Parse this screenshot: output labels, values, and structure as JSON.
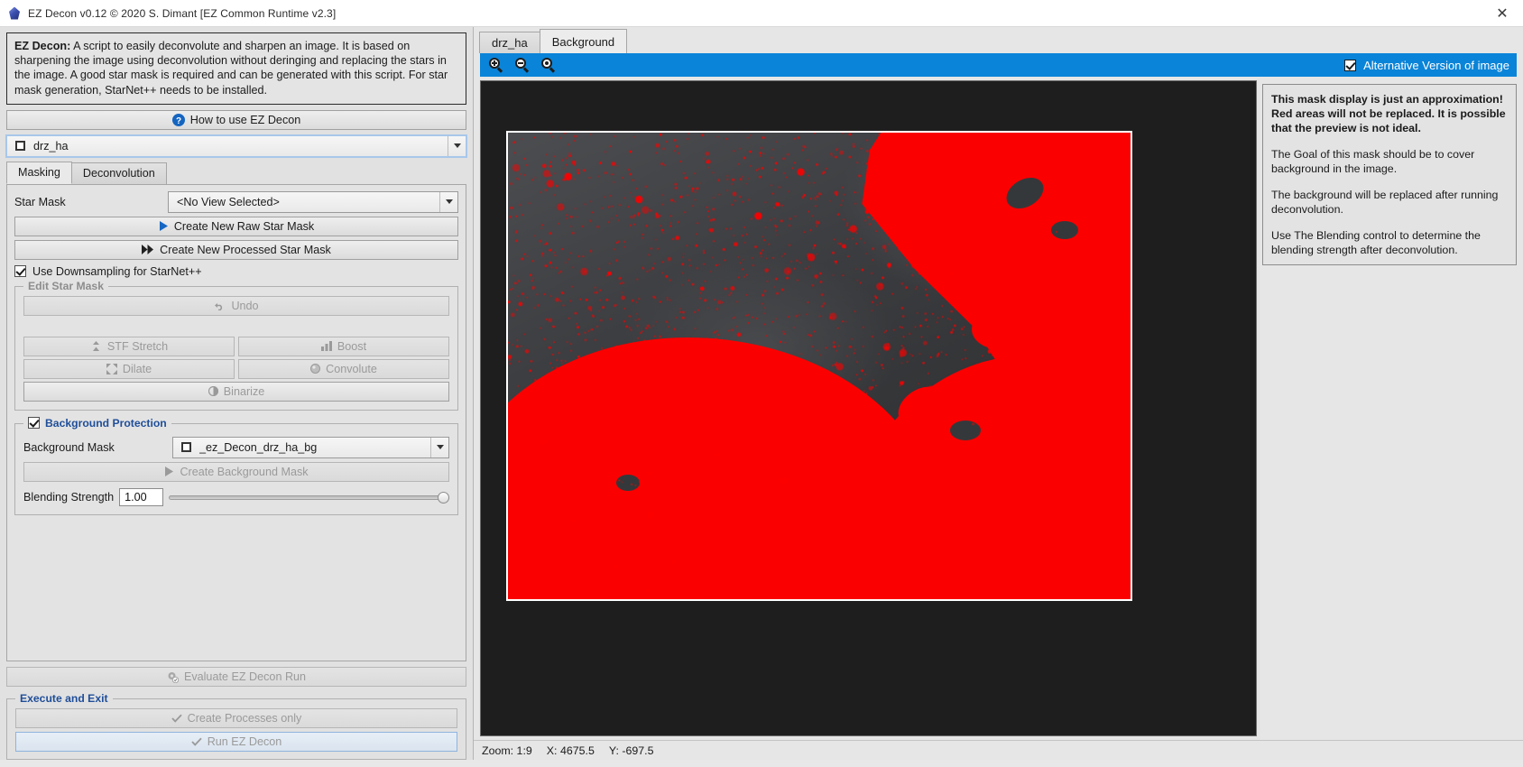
{
  "window": {
    "title": "EZ Decon v0.12 © 2020 S. Dimant [EZ Common Runtime v2.3]",
    "close_label": "✕",
    "app_icon": "diamond-gem-icon"
  },
  "left": {
    "description_lead": "EZ Decon:",
    "description_body": " A script to easily deconvolute and sharpen an image. It is based on sharpening the image using deconvolution without deringing and replacing the stars in the image. A good star mask is required and can be generated with this script. For star mask generation, StarNet++ needs to be installed.",
    "help_button": "How to use EZ Decon",
    "target_view": "drz_ha",
    "tabs": [
      {
        "label": "Masking",
        "active": true
      },
      {
        "label": "Deconvolution",
        "active": false
      }
    ],
    "star_mask": {
      "label": "Star Mask",
      "value": "<No View Selected>",
      "create_raw": "Create New Raw Star Mask",
      "create_processed": "Create New Processed Star Mask",
      "downsampling_label": "Use Downsampling for StarNet++",
      "downsampling_checked": true
    },
    "edit_star_mask": {
      "title": "Edit Star Mask",
      "undo": "Undo",
      "stf_stretch": "STF Stretch",
      "boost": "Boost",
      "dilate": "Dilate",
      "convolute": "Convolute",
      "binarize": "Binarize"
    },
    "background_protection": {
      "title": "Background Protection",
      "checked": true,
      "mask_label": "Background Mask",
      "mask_value": "_ez_Decon_drz_ha_bg",
      "create_mask": "Create Background Mask",
      "blending_label": "Blending Strength",
      "blending_value": "1.00"
    },
    "evaluate_button": "Evaluate EZ Decon Run",
    "execute_group": {
      "title": "Execute and Exit",
      "create_processes": "Create Processes only",
      "run": "Run EZ Decon"
    }
  },
  "right": {
    "tabs": [
      {
        "label": "drz_ha",
        "active": false
      },
      {
        "label": "Background",
        "active": true
      }
    ],
    "toolbar": {
      "zoom_in": "zoom-in-icon",
      "zoom_out": "zoom-out-icon",
      "zoom_fit": "zoom-actual-icon",
      "alt_version_label": "Alternative Version of image",
      "alt_version_checked": true
    },
    "note": {
      "warning": "This mask display is just an approximation! Red areas will not be replaced. It is possible that the preview is not ideal.",
      "goal": "The Goal of this mask should be to cover background in the image.",
      "replace": "The background will be replaced after running deconvolution.",
      "blending": "Use The Blending control to determine the blending strength after deconvolution."
    },
    "status": {
      "zoom": "Zoom: 1:9",
      "x": "X: 4675.5",
      "y": "Y: -697.5"
    }
  },
  "colors": {
    "toolbar_blue": "#0a84d8",
    "mask_red": "#fb0000",
    "group_title_blue": "#1f4e99",
    "canvas_dark": "#1e1e1e"
  }
}
